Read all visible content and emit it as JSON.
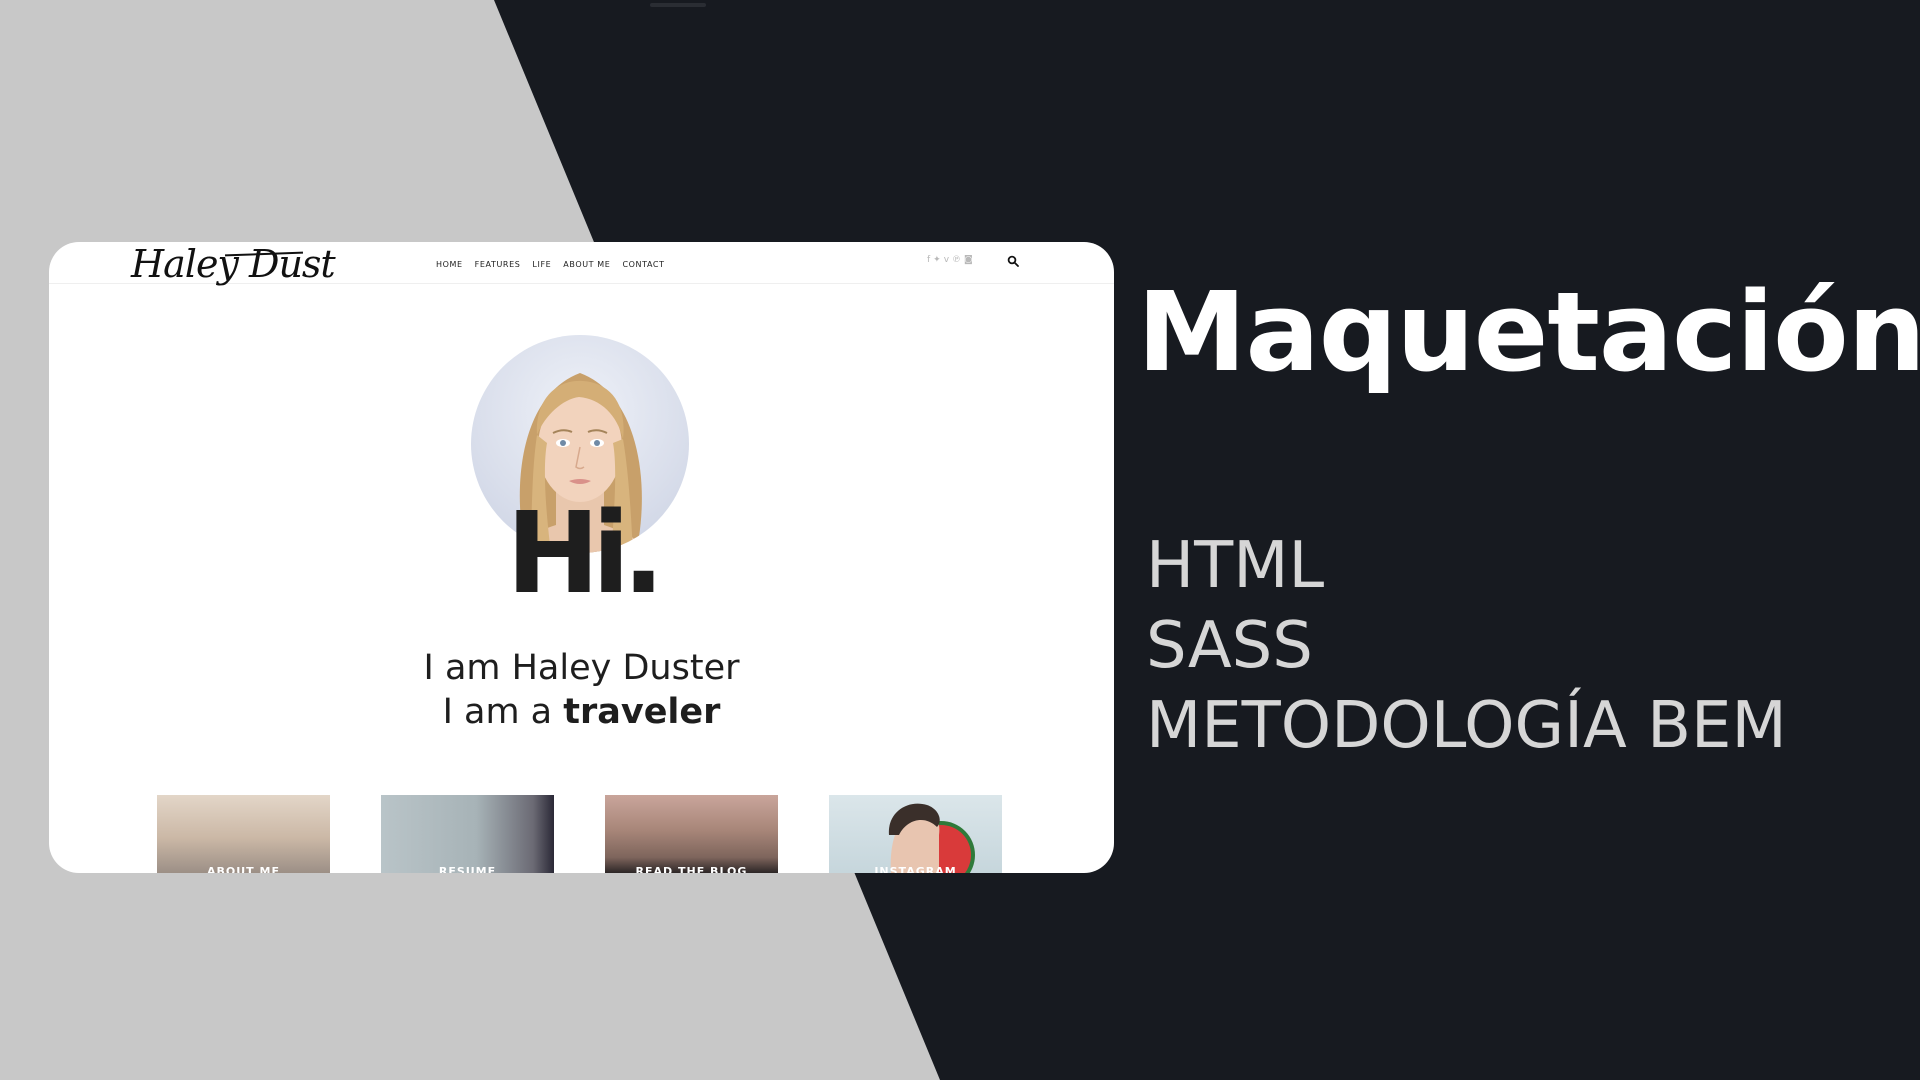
{
  "background": {
    "dark_color": "#171a20",
    "light_color": "#c8c8c8"
  },
  "mockup": {
    "logo": "Haley Dust",
    "nav": [
      "HOME",
      "FEATURES",
      "LIFE",
      "ABOUT ME",
      "CONTACT"
    ],
    "social_icons": [
      "facebook-icon",
      "twitter-icon",
      "vimeo-icon",
      "pinterest-icon",
      "instagram-icon"
    ],
    "hero": {
      "greeting": "Hi.",
      "line1": "I am Haley Duster",
      "line2_prefix": "I am a ",
      "line2_bold": "traveler"
    },
    "tiles": [
      "ABOUT ME",
      "RESUME",
      "READ THE BLOG",
      "INSTAGRAM"
    ]
  },
  "slide": {
    "title": "Maquetación",
    "items": [
      "HTML",
      "SASS",
      "METODOLOGÍA BEM"
    ]
  }
}
